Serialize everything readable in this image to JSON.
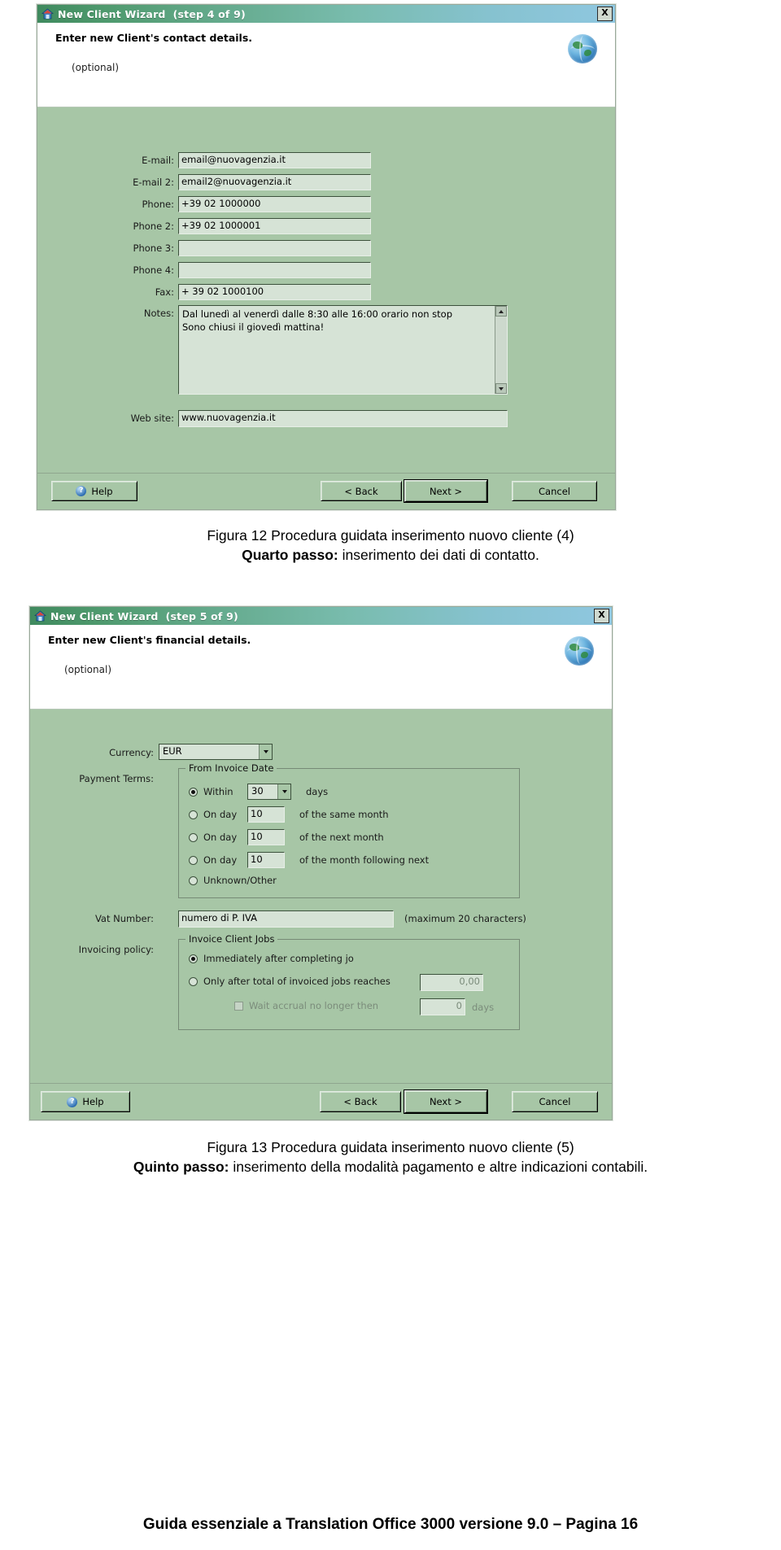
{
  "document": {
    "footer_text": "Guida essenziale a Translation Office 3000 versione 9.0 – Pagina",
    "page_number": "16"
  },
  "captions": [
    {
      "figure_line": "Figura 12 Procedura guidata inserimento nuovo cliente (4)",
      "step_bold": "Quarto passo:",
      "step_rest": " inserimento dei dati di contatto."
    },
    {
      "figure_line": "Figura 13 Procedura guidata inserimento nuovo cliente (5)",
      "step_bold": "Quinto passo:",
      "step_rest": " inserimento della modalità pagamento e altre indicazioni contabili."
    }
  ],
  "dialog1": {
    "title": "New Client Wizard",
    "step": "(step 4 of 9)",
    "close_label": "X",
    "header_title": "Enter new Client's contact details.",
    "header_sub": "(optional)",
    "fields": [
      {
        "label": "E-mail:",
        "value": "email@nuovagenzia.it"
      },
      {
        "label": "E-mail 2:",
        "value": "email2@nuovagenzia.it"
      },
      {
        "label": "Phone:",
        "value": "+39 02 1000000"
      },
      {
        "label": "Phone 2:",
        "value": "+39 02 1000001"
      },
      {
        "label": "Phone 3:",
        "value": ""
      },
      {
        "label": "Phone 4:",
        "value": ""
      },
      {
        "label": "Fax:",
        "value": "+ 39 02 1000100"
      }
    ],
    "notes_label": "Notes:",
    "notes_value": "Dal lunedì al venerdì dalle 8:30 alle 16:00 orario non stop\nSono chiusi il giovedì mattina!",
    "website_label": "Web site:",
    "website_value": "www.nuovagenzia.it",
    "buttons": {
      "help": "Help",
      "back": "< Back",
      "next": "Next >",
      "cancel": "Cancel"
    }
  },
  "dialog2": {
    "title": "New Client Wizard",
    "step": "(step 5 of 9)",
    "close_label": "X",
    "header_title": "Enter new Client's financial details.",
    "header_sub": "(optional)",
    "currency_label": "Currency:",
    "currency_value": "EUR",
    "payment_terms_label": "Payment Terms:",
    "payment_group_title": "From Invoice Date",
    "payment_options": [
      {
        "selected": true,
        "prefix": "Within",
        "value": "30",
        "suffix": "days",
        "has_combo": true
      },
      {
        "selected": false,
        "prefix": "On day",
        "value": "10",
        "suffix": "of the same month",
        "has_combo": false
      },
      {
        "selected": false,
        "prefix": "On day",
        "value": "10",
        "suffix": "of the next month",
        "has_combo": false
      },
      {
        "selected": false,
        "prefix": "On day",
        "value": "10",
        "suffix": "of the month following next",
        "has_combo": false
      },
      {
        "selected": false,
        "prefix": "Unknown/Other",
        "value": "",
        "suffix": "",
        "has_combo": false
      }
    ],
    "vat_label": "Vat Number:",
    "vat_value": "numero di P. IVA",
    "vat_hint": "(maximum 20 characters)",
    "invoicing_label": "Invoicing policy:",
    "invoicing_group_title": "Invoice Client Jobs",
    "invoicing_options": [
      {
        "selected": true,
        "text": "Immediately after completing jo"
      },
      {
        "selected": false,
        "text": "Only after total of invoiced jobs reaches",
        "amount": "0,00"
      }
    ],
    "wait_accrual_label": "Wait accrual no longer then",
    "wait_accrual_value": "0",
    "wait_accrual_unit": "days",
    "buttons": {
      "help": "Help",
      "back": "< Back",
      "next": "Next >",
      "cancel": "Cancel"
    }
  },
  "colors": {
    "dialog_face": "#a7c6a6",
    "field_face": "#d6e3d6",
    "title_left": "#3f8a5e",
    "title_right": "#8fc7e0"
  }
}
